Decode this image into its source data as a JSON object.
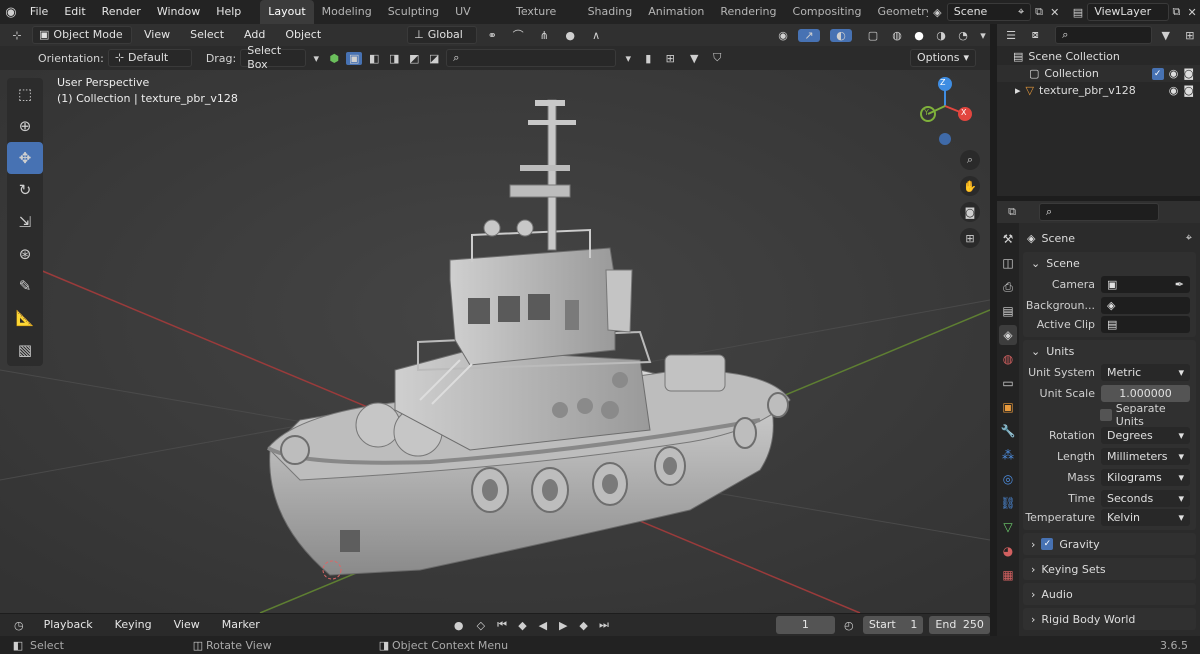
{
  "topbar": {
    "menus": [
      "File",
      "Edit",
      "Render",
      "Window",
      "Help"
    ],
    "workspaces": [
      "Layout",
      "Modeling",
      "Sculpting",
      "UV Editing",
      "Texture Paint",
      "Shading",
      "Animation",
      "Rendering",
      "Compositing",
      "Geometry Noc"
    ],
    "scene_name": "Scene",
    "view_layer": "ViewLayer"
  },
  "viewport_header": {
    "mode": "Object Mode",
    "menus": [
      "View",
      "Select",
      "Add",
      "Object"
    ],
    "transform_orientation": "Global"
  },
  "tool_settings": {
    "orientation_label": "Orientation:",
    "orientation_value": "Default",
    "drag_label": "Drag:",
    "drag_value": "Select Box",
    "options_label": "Options"
  },
  "viewport": {
    "view_name": "User Perspective",
    "object_info": "(1) Collection | texture_pbr_v128",
    "gizmo_x": "X",
    "gizmo_y": "Y",
    "gizmo_z": "Z"
  },
  "timeline": {
    "playback": "Playback",
    "keying": "Keying",
    "view": "View",
    "marker": "Marker",
    "current_frame": "1",
    "start_label": "Start",
    "start": "1",
    "end_label": "End",
    "end": "250"
  },
  "statusbar": {
    "select": "Select",
    "rotate": "Rotate View",
    "context": "Object Context Menu",
    "version": "3.6.5"
  },
  "outliner": {
    "scene_collection": "Scene Collection",
    "collection": "Collection",
    "object": "texture_pbr_v128"
  },
  "properties": {
    "scene_title": "Scene",
    "panel_scene": "Scene",
    "camera_label": "Camera",
    "background_label": "Backgroun...",
    "active_clip_label": "Active Clip",
    "panel_units": "Units",
    "unit_system_label": "Unit System",
    "unit_system": "Metric",
    "unit_scale_label": "Unit Scale",
    "unit_scale": "1.000000",
    "separate_units": "Separate Units",
    "rotation_label": "Rotation",
    "rotation": "Degrees",
    "length_label": "Length",
    "length": "Millimeters",
    "mass_label": "Mass",
    "mass": "Kilograms",
    "time_label": "Time",
    "time": "Seconds",
    "temperature_label": "Temperature",
    "temperature": "Kelvin",
    "gravity": "Gravity",
    "keying_sets": "Keying Sets",
    "audio": "Audio",
    "rigid_body_world": "Rigid Body World"
  },
  "colors": {
    "accent": "#4772b3",
    "viewport_bg": "#3a3a3a",
    "axis_x": "#e2463f",
    "axis_y": "#7fb13b",
    "axis_z": "#3f8de2"
  }
}
